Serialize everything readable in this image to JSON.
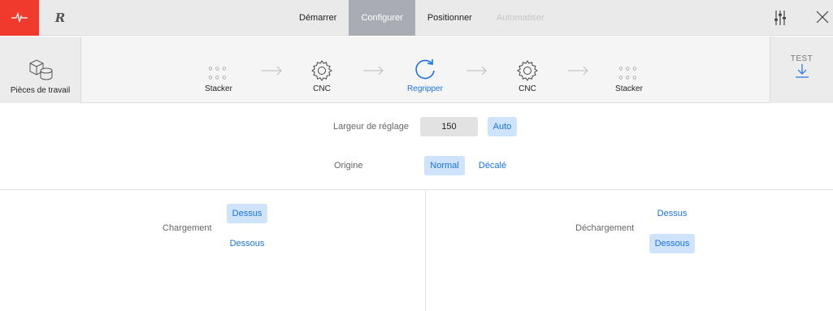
{
  "topbar": {
    "tabs": [
      {
        "label": "Démarrer",
        "state": "normal"
      },
      {
        "label": "Configurer",
        "state": "active"
      },
      {
        "label": "Positionner",
        "state": "normal"
      },
      {
        "label": "Automatiser",
        "state": "disabled"
      }
    ],
    "brand_color": "#f03a2e",
    "logo_letter": "R",
    "icons": [
      "pulse-icon",
      "robot-logo-icon",
      "sliders-icon",
      "close-icon"
    ]
  },
  "workflow": {
    "pieces_label": "Pièces de travail",
    "steps": [
      {
        "label": "Stacker",
        "icon": "dots-grid-icon",
        "active": false
      },
      {
        "label": "CNC",
        "icon": "gear-icon",
        "active": false
      },
      {
        "label": "Regripper",
        "icon": "rotate-icon",
        "active": true
      },
      {
        "label": "CNC",
        "icon": "gear-icon",
        "active": false
      },
      {
        "label": "Stacker",
        "icon": "dots-grid-icon",
        "active": false
      }
    ],
    "test_label": "TEST",
    "accent_color": "#1a73e8"
  },
  "settings": {
    "largeur_label": "Largeur de réglage",
    "largeur_value": "150",
    "auto_label": "Auto",
    "origine_label": "Origine",
    "origine_options": [
      "Normal",
      "Décalé"
    ],
    "origine_selected": "Normal"
  },
  "chargement": {
    "label": "Chargement",
    "options": [
      "Dessus",
      "Dessous"
    ],
    "selected": "Dessus"
  },
  "dechargement": {
    "label": "Déchargement",
    "options": [
      "Dessus",
      "Dessous"
    ],
    "selected": "Dessous"
  }
}
